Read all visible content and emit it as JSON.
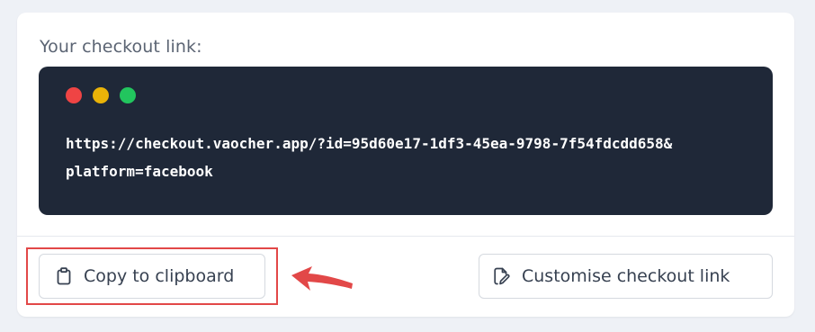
{
  "checkout": {
    "label": "Your checkout link:",
    "url_line1": "https://checkout.vaocher.app/?id=95d60e17-1df3-45ea-9798-7f54fdcdd658&",
    "url_line2": "platform=facebook"
  },
  "window_controls": {
    "colors": [
      "#ef4444",
      "#eab308",
      "#22c55e"
    ]
  },
  "actions": {
    "copy_label": "Copy to clipboard",
    "copy_icon": "clipboard-icon",
    "customise_label": "Customise checkout link",
    "customise_icon": "edit-document-icon"
  },
  "annotation": {
    "highlight_color": "#e24848",
    "arrow_icon": "pointer-arrow-icon"
  }
}
